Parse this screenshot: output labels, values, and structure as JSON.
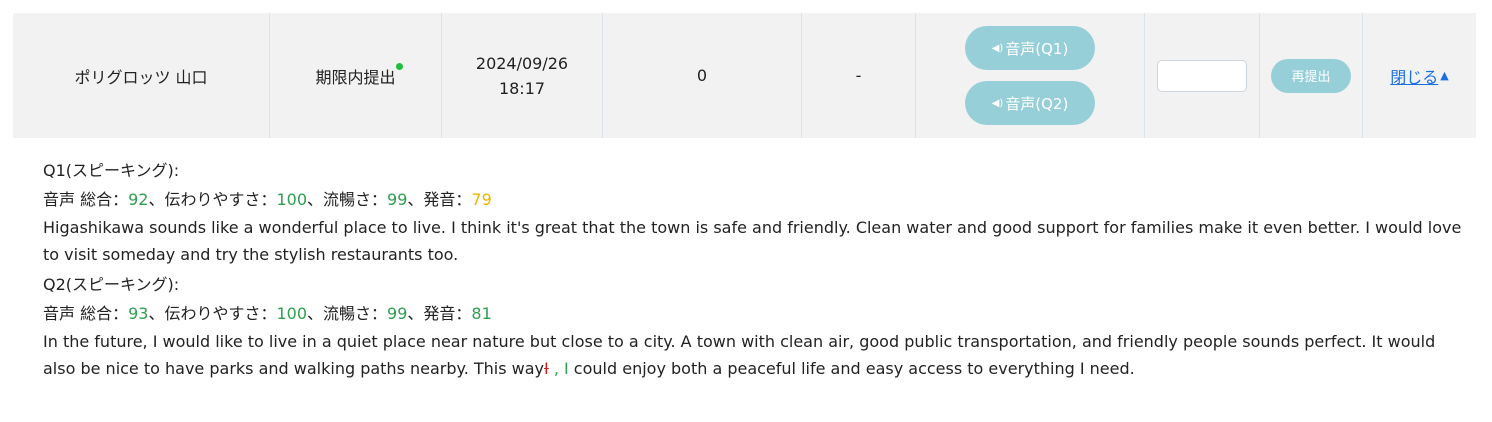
{
  "row": {
    "student_name": "ポリグロッツ 山口",
    "status": "期限内提出",
    "submitted_date": "2024/09/26",
    "submitted_time": "18:17",
    "score": "0",
    "grade": "-",
    "audio_q1_label": "音声(Q1)",
    "audio_q2_label": "音声(Q2)",
    "score_input_value": "",
    "resubmit_label": "再提出",
    "close_label": "閉じる"
  },
  "icons": {
    "speaker": "speaker-icon",
    "status_dot": "green-dot-icon",
    "collapse": "triangle-up-icon"
  },
  "colors": {
    "button_bg": "#97cfd8",
    "score_green": "#2e9e4f",
    "score_yellow": "#f0b400",
    "link_blue": "#1a6fe0",
    "correction_red": "#cc1e1e"
  },
  "q1": {
    "title": "Q1(スピーキング):",
    "score_prefix": "音声 総合：",
    "overall": "92",
    "clarity_label": "、伝わりやすさ：",
    "clarity": "100",
    "fluency_label": "、流暢さ：",
    "fluency": "99",
    "pronunciation_label": "、発音：",
    "pronunciation": "79",
    "answer": "Higashikawa sounds like a wonderful place to live. I think it's great that the town is safe and friendly. Clean water and good support for families make it even better. I would love to visit someday and try the stylish restaurants too."
  },
  "q2": {
    "title": "Q2(スピーキング):",
    "score_prefix": "音声 総合：",
    "overall": "93",
    "clarity_label": "、伝わりやすさ：",
    "clarity": "100",
    "fluency_label": "、流暢さ：",
    "fluency": "99",
    "pronunciation_label": "、発音：",
    "pronunciation": "81",
    "answer_before": "In the future, I would like to live in a quiet place near nature but close to a city. A town with clean air, good public transportation, and friendly people sounds perfect. It would also be nice to have parks and walking paths nearby. This way",
    "answer_deleted": "I",
    "answer_inserted": ", I",
    "answer_after": " could enjoy both a peaceful life and easy access to everything I need."
  }
}
